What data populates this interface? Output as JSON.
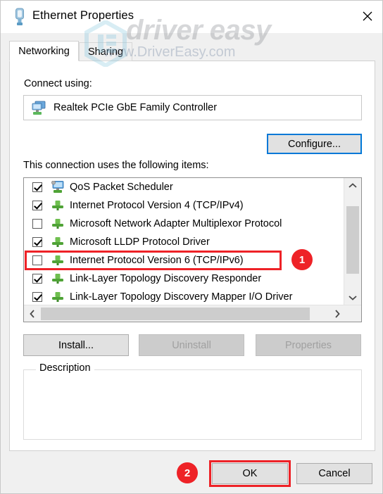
{
  "window": {
    "title": "Ethernet Properties",
    "title_icon": "ethernet-plug-icon",
    "close_label": "✕"
  },
  "watermark": {
    "brand": "driver easy",
    "url": "www.DriverEasy.com"
  },
  "tabs": [
    {
      "label": "Networking",
      "active": true
    },
    {
      "label": "Sharing",
      "active": false
    }
  ],
  "connect_using": {
    "label": "Connect using:",
    "adapter": "Realtek PCIe GbE Family Controller",
    "adapter_icon": "network-adapter-icon"
  },
  "configure_button": {
    "label": "Configure...",
    "focused": true
  },
  "items_section": {
    "label": "This connection uses the following items:",
    "items": [
      {
        "label": "QoS Packet Scheduler",
        "checked": true,
        "icon": "qos-service-icon"
      },
      {
        "label": "Internet Protocol Version 4 (TCP/IPv4)",
        "checked": true,
        "icon": "protocol-plug-icon"
      },
      {
        "label": "Microsoft Network Adapter Multiplexor Protocol",
        "checked": false,
        "icon": "protocol-plug-icon"
      },
      {
        "label": "Microsoft LLDP Protocol Driver",
        "checked": true,
        "icon": "protocol-plug-icon"
      },
      {
        "label": "Internet Protocol Version 6 (TCP/IPv6)",
        "checked": false,
        "icon": "protocol-plug-icon"
      },
      {
        "label": "Link-Layer Topology Discovery Responder",
        "checked": true,
        "icon": "protocol-plug-icon"
      },
      {
        "label": "Link-Layer Topology Discovery Mapper I/O Driver",
        "checked": true,
        "icon": "protocol-plug-icon"
      }
    ]
  },
  "scrollbars": {
    "up_arrow": "˄",
    "down_arrow": "˅",
    "left_arrow": "‹",
    "right_arrow": "›"
  },
  "action_buttons": {
    "install": {
      "label": "Install...",
      "disabled": false
    },
    "uninstall": {
      "label": "Uninstall",
      "disabled": true
    },
    "properties": {
      "label": "Properties",
      "disabled": true
    }
  },
  "description": {
    "legend": "Description",
    "text": ""
  },
  "footer_buttons": {
    "ok": "OK",
    "cancel": "Cancel"
  },
  "annotations": {
    "badge_1": "1",
    "badge_2": "2",
    "highlight_color": "#ee2227"
  }
}
